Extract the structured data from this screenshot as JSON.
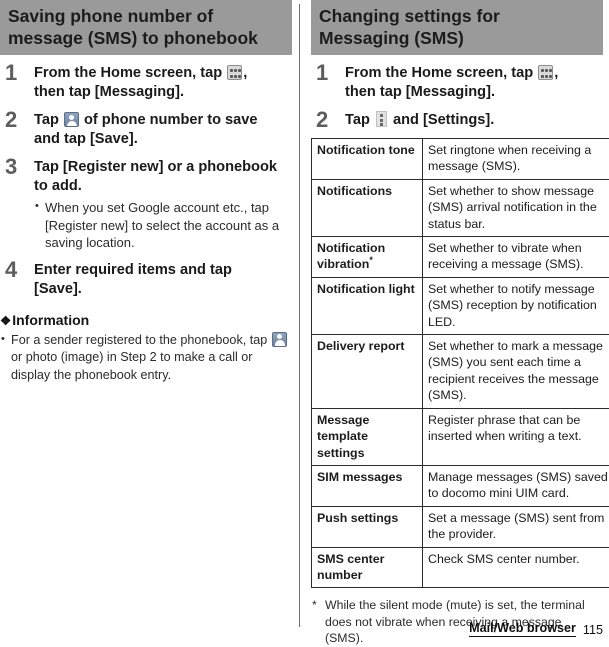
{
  "left_column": {
    "section_title_line1": "Saving phone number of",
    "section_title_line2": "message (SMS) to phonebook",
    "steps": [
      {
        "number": "1",
        "text_before_icon": "From the Home screen, tap ",
        "icon": "app-drawer-icon",
        "text_after_icon": ",",
        "text_line2": "then tap [Messaging]."
      },
      {
        "number": "2",
        "text_before_icon": "Tap ",
        "icon": "contact-icon",
        "text_after_icon": " of phone number to save",
        "text_line2": "and tap [Save]."
      },
      {
        "number": "3",
        "text_line1": "Tap [Register new] or a phonebook",
        "text_line2": "to add.",
        "bullets": [
          "When you set Google account etc., tap [Register new] to select the account as a saving location."
        ]
      },
      {
        "number": "4",
        "text_line1": "Enter required items and tap",
        "text_line2": "[Save]."
      }
    ],
    "information": {
      "diamond_glyph": "❖",
      "heading": "Information",
      "bullets_part1": "For a sender registered to the phonebook, tap ",
      "bullets_icon": "contact-icon",
      "bullets_part2": " or photo (image) in Step 2 to make a call or display the phonebook entry."
    }
  },
  "right_column": {
    "section_title_line1": "Changing settings for",
    "section_title_line2": "Messaging (SMS)",
    "steps": [
      {
        "number": "1",
        "text_before_icon": "From the Home screen, tap ",
        "icon": "app-drawer-icon",
        "text_after_icon": ",",
        "text_line2": "then tap [Messaging]."
      },
      {
        "number": "2",
        "text_before_icon": "Tap ",
        "icon": "overflow-menu-icon",
        "text_after_icon": " and [Settings]."
      }
    ],
    "settings_table": {
      "rows": [
        {
          "name": "Notification tone",
          "has_asterisk": false,
          "description": "Set ringtone when receiving a message (SMS)."
        },
        {
          "name": "Notifications",
          "has_asterisk": false,
          "description": "Set whether to show message (SMS) arrival notification in the status bar."
        },
        {
          "name": "Notification vibration",
          "has_asterisk": true,
          "asterisk": "*",
          "description": "Set whether to vibrate when receiving a message (SMS)."
        },
        {
          "name": "Notification light",
          "has_asterisk": false,
          "description": "Set whether to notify message (SMS) reception by notification LED."
        },
        {
          "name": "Delivery report",
          "has_asterisk": false,
          "description": "Set whether to mark a message (SMS) you sent each time a recipient receives the message (SMS)."
        },
        {
          "name": "Message template settings",
          "has_asterisk": false,
          "description": "Register phrase that can be inserted when writing a text."
        },
        {
          "name": "SIM messages",
          "has_asterisk": false,
          "description": "Manage messages (SMS) saved to docomo mini UIM card."
        },
        {
          "name": "Push settings",
          "has_asterisk": false,
          "description": "Set a message (SMS) sent from the provider."
        },
        {
          "name": "SMS center number",
          "has_asterisk": false,
          "description": "Check SMS center number."
        }
      ]
    },
    "footnote": {
      "mark": "*",
      "text": "While the silent mode (mute) is set, the terminal does not vibrate when receiving a message (SMS)."
    }
  },
  "footer": {
    "chapter": "Mail/Web browser",
    "page_number": "115"
  },
  "colors": {
    "section_bar_bg": "#9a9a9a",
    "step_number": "#5d5d5d",
    "text": "#1a1a1a",
    "table_border": "#2b2b2b"
  }
}
